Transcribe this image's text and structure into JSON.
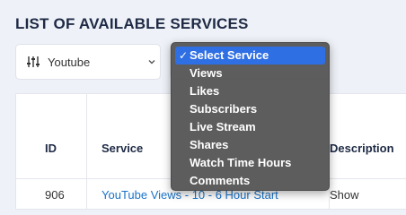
{
  "heading": "LIST OF AVAILABLE SERVICES",
  "platform_select": {
    "value": "Youtube"
  },
  "service_dropdown": {
    "options": [
      {
        "label": "Select Service",
        "selected": true
      },
      {
        "label": "Views"
      },
      {
        "label": "Likes"
      },
      {
        "label": "Subscribers"
      },
      {
        "label": "Live Stream"
      },
      {
        "label": "Shares"
      },
      {
        "label": "Watch Time Hours"
      },
      {
        "label": "Comments"
      }
    ],
    "check_mark": "✓"
  },
  "table": {
    "headers": {
      "id": "ID",
      "service": "Service",
      "description": "Description"
    },
    "rows": [
      {
        "id": "906",
        "service": "YouTube Views - 10 - 6 Hour Start",
        "description": "Show"
      }
    ]
  },
  "colors": {
    "heading": "#1e2a45",
    "link": "#1a73c8",
    "selected_option": "#2f6fe4",
    "dropdown_bg": "#585858",
    "page_bg": "#eef1f7"
  }
}
